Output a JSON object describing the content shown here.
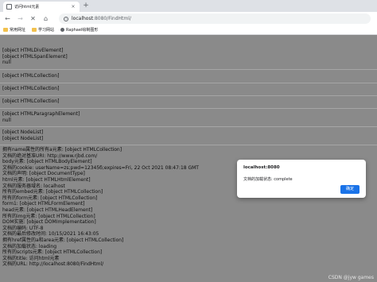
{
  "browser": {
    "tab_title": "访问html元素",
    "tab_close": "×",
    "new_tab": "+",
    "url_host": "localhost",
    "url_path": ":8080/FindHtml/",
    "bookmarks": [
      {
        "label": "常用网址",
        "icon": "folder-icon"
      },
      {
        "label": "学习网站",
        "icon": "folder-icon"
      },
      {
        "label": "Raphael绘制图形",
        "icon": "raphael-icon"
      }
    ]
  },
  "content": {
    "block1": [
      "[object HTMLDivElement]",
      "[object HTMLSpanElement]",
      "null"
    ],
    "block2": [
      "[object HTMLCollection]"
    ],
    "block3": [
      "[object HTMLCollection]"
    ],
    "block4": [
      "[object HTMLCollection]"
    ],
    "block5": [
      "[object HTMLParagraphElement]",
      "null"
    ],
    "block6": [
      "[object NodeList]",
      "[object NodeList]"
    ],
    "block7": [
      "拥有name属性的所有a元素: [object HTMLCollection]",
      "文档的绝对基准URI: http://www.rjbd.com/",
      "body元素: [object HTMLBodyElement]",
      "文档的cookie: userName=zs;pwd=12345б;expires=Fri, 22 Oct 2021 08:47:18 GMT",
      "文档的声明: [object DocumentType]",
      "html元素: [object HTMLHtmlElement]",
      "文档的服务器域名: localhost",
      "所有的embed元素: [object HTMLCollection]",
      "所有的form元素: [object HTMLCollection]",
      "form1: [object HTMLFormElement]",
      "head元素: [object HTMLHeadElement]",
      "所有的img元素: [object HTMLCollection]",
      "DOM实施: [object DOMImplementation]",
      "文档的编码: UTF-8",
      "文档的最后修改时间: 10/15/2021 16:43:05",
      "拥有href属性的a和area元素: [object HTMLCollection]",
      "文档的加载状态: loading",
      "所有的scripts元素: [object HTMLCollection]",
      "文档的title: 访问html元素",
      "文档的URL: http://localhost:8080/FindHtml/"
    ]
  },
  "alert": {
    "title": "localhost:8080",
    "message": "文档的加载状态: complete",
    "ok_label": "确定"
  },
  "watermark": "CSDN @jyw games"
}
